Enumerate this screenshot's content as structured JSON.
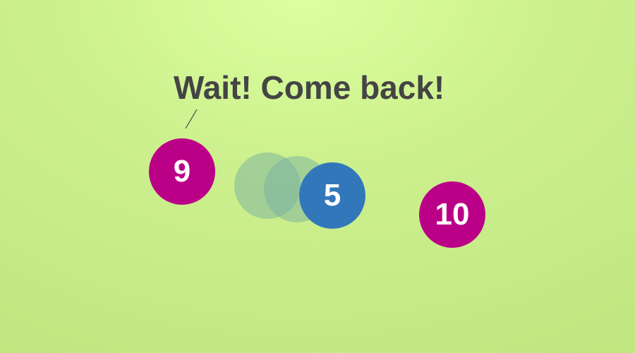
{
  "speech": {
    "text": "Wait! Come back!"
  },
  "balls": {
    "left": {
      "label": "9",
      "color": "#bb0088"
    },
    "moving": {
      "label": "5",
      "color": "#3377bb"
    },
    "right": {
      "label": "10",
      "color": "#bb0088"
    }
  },
  "motion_trail": {
    "color": "#78afa0",
    "count": 2
  },
  "background": {
    "color_top": "#ddff9f",
    "color_bottom": "#bfe57f"
  },
  "text_color": "#444444"
}
